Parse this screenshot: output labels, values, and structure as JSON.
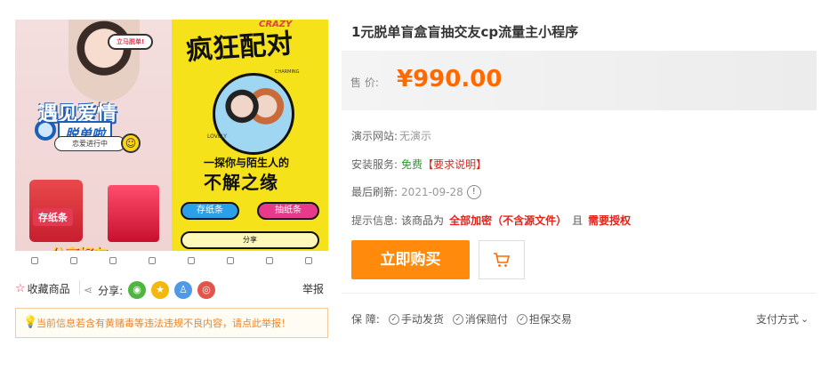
{
  "gallery": {
    "left_phone": {
      "badge": "立马脱单!",
      "headline": "遇见爱情",
      "banner": "脱单啦",
      "tag": "恋爱进行中",
      "button_savepaper": "存纸条",
      "footer_text": "分享好友"
    },
    "right_phone": {
      "crazy_title": "疯狂配对",
      "crazy_word": "CRAZY",
      "charming": "CHARMING",
      "lovely": "LOVELY",
      "slogan_line1": "一探你与陌生人的",
      "slogan_line2": "不解之缘",
      "button_save": "存纸条",
      "button_draw": "抽纸条",
      "button_share": "分享"
    }
  },
  "actions": {
    "collect_label": "收藏商品",
    "share_label": "分享:",
    "report_label": "举报"
  },
  "notice": {
    "text": "当前信息若含有黄赌毒等违法违规不良内容，请点此举报！"
  },
  "product": {
    "title": "1元脱单盲盒盲抽交友cp流量主小程序",
    "price_label": "售 价:",
    "price": "¥990.00",
    "demo_label": "演示网站:",
    "demo_value": "无演示",
    "service_label": "安装服务:",
    "service_free": "免费",
    "service_note": "【要求说明】",
    "refresh_label": "最后刷新:",
    "refresh_date": "2021-09-28",
    "hint_label": "提示信息:",
    "hint_prefix": "该商品为",
    "hint_encrypt": "全部加密（不含源文件）",
    "hint_and": "且",
    "hint_auth": "需要授权",
    "buy_label": "立即购买"
  },
  "guarantee": {
    "label": "保 障:",
    "items": [
      "手动发货",
      "消保赔付",
      "担保交易"
    ],
    "pay_methods": "支付方式"
  },
  "colors": {
    "price": "#ff6a00",
    "buy_button": "#ff8a0c",
    "accent_red": "#e2231a",
    "free_green": "#2a9a2a"
  }
}
